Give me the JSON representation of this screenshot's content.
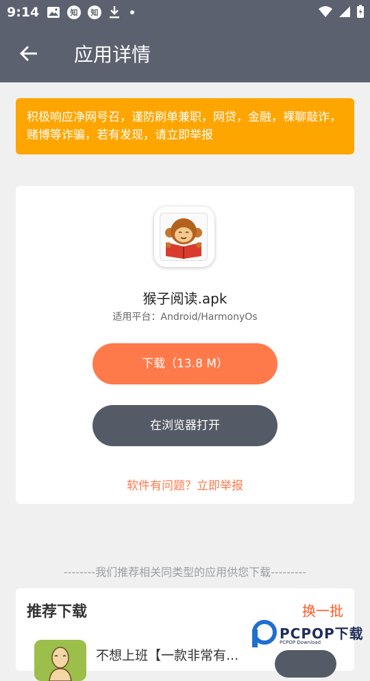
{
  "status_bar": {
    "time": "9:14",
    "zhihu_1": "知",
    "zhihu_2": "知"
  },
  "app_bar": {
    "title": "应用详情"
  },
  "notice": {
    "text": "积极响应净网号召，谨防刷单兼职，网贷，金融，裸聊敲诈，赌博等诈骗，若有发现，请立即举报"
  },
  "app": {
    "name": "猴子阅读.apk",
    "platform": "适用平台：Android/HarmonyOs",
    "download_label": "下载（13.8 M）",
    "browser_label": "在浏览器打开",
    "report_label": "软件有问题？立即举报"
  },
  "recommend": {
    "divider": "--------我们推荐相关同类型的应用供您下载---------",
    "title": "推荐下载",
    "refresh": "换一批",
    "items": [
      {
        "name": "不想上班【一款非常有..."
      }
    ]
  },
  "watermark": {
    "brand": "PCPOP下载",
    "sub": "PCPOP Download"
  },
  "colors": {
    "header": "#5b616e",
    "notice": "#ffa500",
    "download": "#ff7a4b",
    "browser": "#555b66",
    "refresh": "#ff5722"
  }
}
